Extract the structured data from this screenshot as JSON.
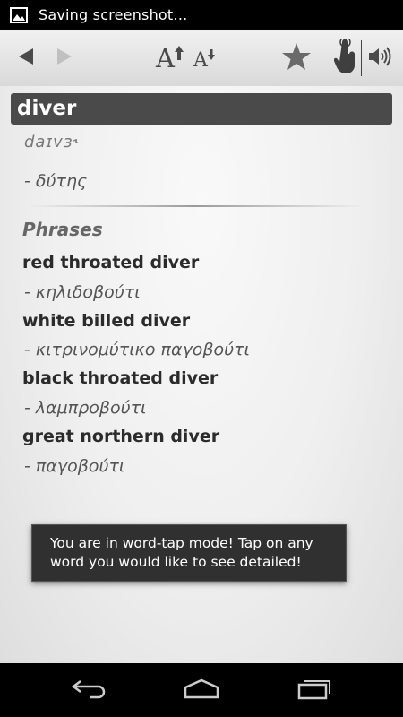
{
  "status_bar": {
    "text": "Saving screenshot…",
    "icon": "picture-icon"
  },
  "toolbar": {
    "icons": [
      "back-arrow-icon",
      "forward-arrow-icon",
      "font-increase-icon",
      "font-decrease-icon",
      "star-icon",
      "hand-pointer-icon",
      "speaker-icon"
    ],
    "font_increase_glyph": "A",
    "font_decrease_glyph": "A"
  },
  "entry": {
    "headword": "diver",
    "pronunciation": "daɪvɜ˞",
    "translation": " - δύτης"
  },
  "phrases": {
    "title": "Phrases",
    "items": [
      {
        "phrase": "red throated diver",
        "translation": " - κηλιδοβούτι"
      },
      {
        "phrase": "white billed diver",
        "translation": " - κιτρινομύτικο παγοβούτι"
      },
      {
        "phrase": "black throated diver",
        "translation": " - λαμπροβούτι"
      },
      {
        "phrase": "great northern diver",
        "translation": " - παγοβούτι"
      }
    ]
  },
  "toast": {
    "line1": "You are in word-tap mode! Tap on any",
    "line2": "word you would like to see detailed!"
  },
  "nav_bar": {
    "icons": [
      "back-icon",
      "home-icon",
      "recent-apps-icon"
    ]
  },
  "colors": {
    "headword_bar": "#4a4a4a",
    "toolbar_icon": "#555555",
    "disabled_icon": "#c0c0c0"
  }
}
